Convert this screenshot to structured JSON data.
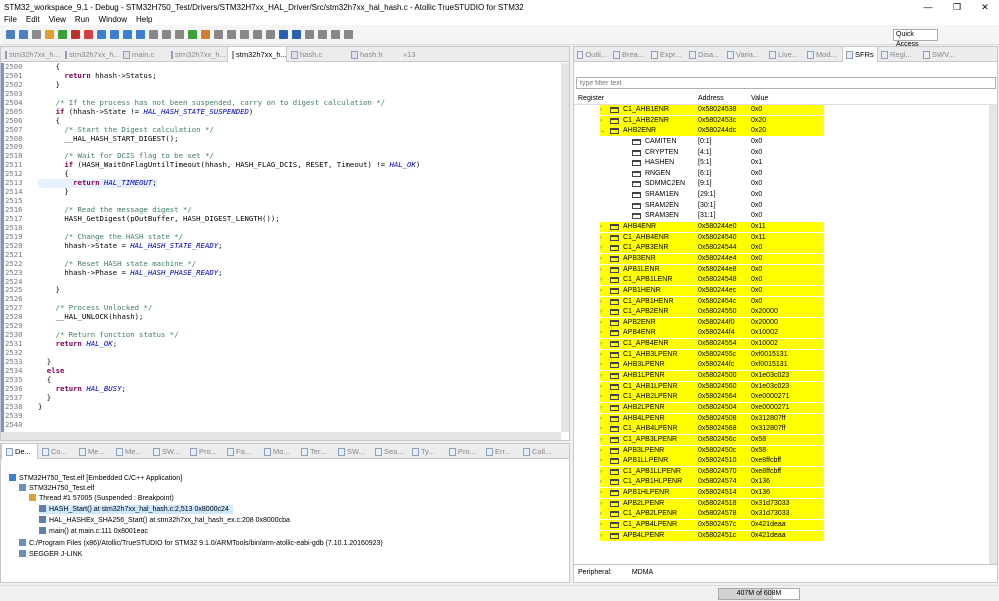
{
  "title": "STM32_workspace_9.1 - Debug - STM32H750_Test/Drivers/STM32H7xx_HAL_Driver/Src/stm32h7xx_hal_hash.c - Atollic TrueSTUDIO for STM32",
  "window_controls": [
    "—",
    "❐",
    "✕"
  ],
  "menu": [
    "File",
    "Edit",
    "View",
    "Run",
    "Window",
    "Help"
  ],
  "quick_access": "Quick Access",
  "editor_tabs": [
    {
      "label": "stm32h7xx_h...",
      "active": false
    },
    {
      "label": "stm32h7xx_h...",
      "active": false
    },
    {
      "label": "main.c",
      "active": false
    },
    {
      "label": "stm32h7xx_h...",
      "active": false
    },
    {
      "label": "stm32h7xx_h...",
      "active": true
    },
    {
      "label": "hash.c",
      "active": false
    },
    {
      "label": "hash.h",
      "active": false
    },
    {
      "label": "»13",
      "active": false
    }
  ],
  "code_lines": [
    {
      "n": "2500",
      "t": "    {"
    },
    {
      "n": "2501",
      "t": "      <k>return</k> hhash->Status;"
    },
    {
      "n": "2502",
      "t": "    }"
    },
    {
      "n": "2503",
      "t": ""
    },
    {
      "n": "2504",
      "t": "    <c>/* If the process has not been suspended, carry on to digest calculation */</c>"
    },
    {
      "n": "2505",
      "t": "    <k>if</k> (hhash->State != <i>HAL_HASH_STATE_SUSPENDED</i>)"
    },
    {
      "n": "2506",
      "t": "    {"
    },
    {
      "n": "2507",
      "t": "      <c>/* Start the Digest calculation */</c>"
    },
    {
      "n": "2508",
      "t": "      __HAL_HASH_START_DIGEST();"
    },
    {
      "n": "2509",
      "t": ""
    },
    {
      "n": "2510",
      "t": "      <c>/* Wait for DCIS flag to be set */</c>"
    },
    {
      "n": "2511",
      "t": "      <k>if</k> (HASH_WaitOnFlagUntilTimeout(hhash, HASH_FLAG_DCIS, RESET, Timeout) != <i>HAL_OK</i>)"
    },
    {
      "n": "2512",
      "t": "      {"
    },
    {
      "n": "2513",
      "t": "        <k>return</k> <i>HAL_TIMEOUT</i>;",
      "hl": true
    },
    {
      "n": "2514",
      "t": "      }"
    },
    {
      "n": "2515",
      "t": ""
    },
    {
      "n": "2516",
      "t": "      <c>/* Read the message digest */</c>"
    },
    {
      "n": "2517",
      "t": "      HASH_GetDigest(pOutBuffer, HASH_DIGEST_LENGTH());"
    },
    {
      "n": "2518",
      "t": ""
    },
    {
      "n": "2519",
      "t": "      <c>/* Change the HASH state */</c>"
    },
    {
      "n": "2520",
      "t": "      hhash->State = <i>HAL_HASH_STATE_READY</i>;"
    },
    {
      "n": "2521",
      "t": ""
    },
    {
      "n": "2522",
      "t": "      <c>/* Reset HASH state machine */</c>"
    },
    {
      "n": "2523",
      "t": "      hhash->Phase = <i>HAL_HASH_PHASE_READY</i>;"
    },
    {
      "n": "2524",
      "t": ""
    },
    {
      "n": "2525",
      "t": "    }"
    },
    {
      "n": "2526",
      "t": ""
    },
    {
      "n": "2527",
      "t": "    <c>/* Process Unlocked */</c>"
    },
    {
      "n": "2528",
      "t": "    __HAL_UNLOCK(hhash);"
    },
    {
      "n": "2529",
      "t": ""
    },
    {
      "n": "2530",
      "t": "    <c>/* Return function status */</c>"
    },
    {
      "n": "2531",
      "t": "    <k>return</k> <i>HAL_OK</i>;"
    },
    {
      "n": "2532",
      "t": ""
    },
    {
      "n": "2533",
      "t": "  }"
    },
    {
      "n": "2534",
      "t": "  <k>else</k>"
    },
    {
      "n": "2535",
      "t": "  {"
    },
    {
      "n": "2536",
      "t": "    <k>return</k> <i>HAL_BUSY</i>;"
    },
    {
      "n": "2537",
      "t": "  }"
    },
    {
      "n": "2538",
      "t": "}"
    },
    {
      "n": "2539",
      "t": ""
    },
    {
      "n": "2540",
      "t": ""
    }
  ],
  "right_tabs": [
    "Outli...",
    "Brea...",
    "Expr...",
    "Disa...",
    "Varia...",
    "Live...",
    "Mod...",
    "SFRs",
    "Regi...",
    "SWV..."
  ],
  "filter_placeholder": "type filter text",
  "columns": {
    "register": "Register",
    "address": "Address",
    "value": "Value"
  },
  "sfr_rows": [
    {
      "name": "C1_AHB1ENR",
      "addr": "0x58024538",
      "val": "0x0",
      "y": true,
      "lvl": 0,
      "exp": "›"
    },
    {
      "name": "C1_AHB2ENR",
      "addr": "0x5802453c",
      "val": "0x20",
      "y": true,
      "lvl": 0,
      "exp": "›"
    },
    {
      "name": "AHB2ENR",
      "addr": "0x580244dc",
      "val": "0x20",
      "y": true,
      "lvl": 0,
      "exp": "⌄"
    },
    {
      "name": "CAMITEN",
      "addr": "[0:1]",
      "val": "0x0",
      "y": false,
      "lvl": 1,
      "exp": ""
    },
    {
      "name": "CRYPTEN",
      "addr": "[4:1]",
      "val": "0x0",
      "y": false,
      "lvl": 1,
      "exp": ""
    },
    {
      "name": "HASHEN",
      "addr": "[5:1]",
      "val": "0x1",
      "y": false,
      "lvl": 1,
      "exp": ""
    },
    {
      "name": "RNGEN",
      "addr": "[6:1]",
      "val": "0x0",
      "y": false,
      "lvl": 1,
      "exp": ""
    },
    {
      "name": "SDMMC2EN",
      "addr": "[9:1]",
      "val": "0x0",
      "y": false,
      "lvl": 1,
      "exp": ""
    },
    {
      "name": "SRAM1EN",
      "addr": "[29:1]",
      "val": "0x0",
      "y": false,
      "lvl": 1,
      "exp": ""
    },
    {
      "name": "SRAM2EN",
      "addr": "[30:1]",
      "val": "0x0",
      "y": false,
      "lvl": 1,
      "exp": ""
    },
    {
      "name": "SRAM3EN",
      "addr": "[31:1]",
      "val": "0x0",
      "y": false,
      "lvl": 1,
      "exp": ""
    },
    {
      "name": "AHB4ENR",
      "addr": "0x580244e0",
      "val": "0x11",
      "y": true,
      "lvl": 0,
      "exp": "›"
    },
    {
      "name": "C1_AHB4ENR",
      "addr": "0x58024540",
      "val": "0x11",
      "y": true,
      "lvl": 0,
      "exp": "›"
    },
    {
      "name": "C1_APB3ENR",
      "addr": "0x58024544",
      "val": "0x0",
      "y": true,
      "lvl": 0,
      "exp": "›"
    },
    {
      "name": "APB3ENR",
      "addr": "0x580244e4",
      "val": "0x0",
      "y": true,
      "lvl": 0,
      "exp": "›"
    },
    {
      "name": "APB1LENR",
      "addr": "0x580244e8",
      "val": "0x0",
      "y": true,
      "lvl": 0,
      "exp": "›"
    },
    {
      "name": "C1_APB1LENR",
      "addr": "0x58024548",
      "val": "0x0",
      "y": true,
      "lvl": 0,
      "exp": "›"
    },
    {
      "name": "APB1HENR",
      "addr": "0x580244ec",
      "val": "0x0",
      "y": true,
      "lvl": 0,
      "exp": "›"
    },
    {
      "name": "C1_APB1HENR",
      "addr": "0x5802454c",
      "val": "0x0",
      "y": true,
      "lvl": 0,
      "exp": "›"
    },
    {
      "name": "C1_APB2ENR",
      "addr": "0x58024550",
      "val": "0x20000",
      "y": true,
      "lvl": 0,
      "exp": "›"
    },
    {
      "name": "APB2ENR",
      "addr": "0x580244f0",
      "val": "0x20000",
      "y": true,
      "lvl": 0,
      "exp": "›"
    },
    {
      "name": "APB4ENR",
      "addr": "0x580244f4",
      "val": "0x10002",
      "y": true,
      "lvl": 0,
      "exp": "›"
    },
    {
      "name": "C1_APB4ENR",
      "addr": "0x58024554",
      "val": "0x10002",
      "y": true,
      "lvl": 0,
      "exp": "›"
    },
    {
      "name": "C1_AHB3LPENR",
      "addr": "0x5802455c",
      "val": "0xf0015131",
      "y": true,
      "lvl": 0,
      "exp": "›"
    },
    {
      "name": "AHB3LPENR",
      "addr": "0x580244fc",
      "val": "0xf0015131",
      "y": true,
      "lvl": 0,
      "exp": "›"
    },
    {
      "name": "AHB1LPENR",
      "addr": "0x58024500",
      "val": "0x1e03c023",
      "y": true,
      "lvl": 0,
      "exp": "›"
    },
    {
      "name": "C1_AHB1LPENR",
      "addr": "0x58024560",
      "val": "0x1e03c023",
      "y": true,
      "lvl": 0,
      "exp": "›"
    },
    {
      "name": "C1_AHB2LPENR",
      "addr": "0x58024564",
      "val": "0xe0000271",
      "y": true,
      "lvl": 0,
      "exp": "›"
    },
    {
      "name": "AHB2LPENR",
      "addr": "0x58024504",
      "val": "0xe0000271",
      "y": true,
      "lvl": 0,
      "exp": "›"
    },
    {
      "name": "AHB4LPENR",
      "addr": "0x58024508",
      "val": "0x312807ff",
      "y": true,
      "lvl": 0,
      "exp": "›"
    },
    {
      "name": "C1_AHB4LPENR",
      "addr": "0x58024568",
      "val": "0x312807ff",
      "y": true,
      "lvl": 0,
      "exp": "›"
    },
    {
      "name": "C1_APB3LPENR",
      "addr": "0x5802456c",
      "val": "0x58",
      "y": true,
      "lvl": 0,
      "exp": "›"
    },
    {
      "name": "APB3LPENR",
      "addr": "0x5802450c",
      "val": "0x58",
      "y": true,
      "lvl": 0,
      "exp": "›"
    },
    {
      "name": "APB1LLPENR",
      "addr": "0x58024510",
      "val": "0xe8ffcbff",
      "y": true,
      "lvl": 0,
      "exp": "›"
    },
    {
      "name": "C1_APB1LLPENR",
      "addr": "0x58024570",
      "val": "0xe8ffcbff",
      "y": true,
      "lvl": 0,
      "exp": "›"
    },
    {
      "name": "C1_APB1HLPENR",
      "addr": "0x58024574",
      "val": "0x136",
      "y": true,
      "lvl": 0,
      "exp": "›"
    },
    {
      "name": "APB1HLPENR",
      "addr": "0x58024514",
      "val": "0x136",
      "y": true,
      "lvl": 0,
      "exp": "›"
    },
    {
      "name": "APB2LPENR",
      "addr": "0x58024518",
      "val": "0x31d73033",
      "y": true,
      "lvl": 0,
      "exp": "›"
    },
    {
      "name": "C1_APB2LPENR",
      "addr": "0x58024578",
      "val": "0x31d73033",
      "y": true,
      "lvl": 0,
      "exp": "›"
    },
    {
      "name": "C1_APB4LPENR",
      "addr": "0x5802457c",
      "val": "0x421deaa",
      "y": true,
      "lvl": 0,
      "exp": "›"
    },
    {
      "name": "APB4LPENR",
      "addr": "0x5802451c",
      "val": "0x421deaa",
      "y": true,
      "lvl": 0,
      "exp": "›"
    }
  ],
  "peripheral": {
    "label": "Peripheral:",
    "value": "MDMA"
  },
  "debug_tabs": [
    "De...",
    "Co...",
    "Me...",
    "Me...",
    "SW...",
    "Pro...",
    "Fa...",
    "Mo...",
    "Ter...",
    "SW...",
    "Sea...",
    "Ty...",
    "Pro...",
    "Err...",
    "Call..."
  ],
  "debug_tree": [
    {
      "text": "STM32H750_Test.elf [Embedded C/C++ Application]",
      "lvl": 0,
      "icon": "#3a7fd0"
    },
    {
      "text": "STM32H750_Test.elf",
      "lvl": 1,
      "icon": "#6a8fb8"
    },
    {
      "text": "Thread #1 57005 (Suspended : Breakpoint)",
      "lvl": 2,
      "icon": "#d9a33a"
    },
    {
      "text": "HASH_Start() at stm32h7xx_hal_hash.c:2,513 0x8000c24",
      "lvl": 3,
      "icon": "#5c7fa8",
      "sel": true
    },
    {
      "text": "HAL_HASHEx_SHA256_Start() at stm32h7xx_hal_hash_ex.c:208 0x8000cba",
      "lvl": 3,
      "icon": "#5c7fa8"
    },
    {
      "text": "main() at main.c:111 0x8001eac",
      "lvl": 3,
      "icon": "#5c7fa8"
    },
    {
      "text": "C:/Program Files (x86)/Atollic/TrueSTUDIO for STM32 9.1.0/ARMTools/bin/arm-atollic-eabi-gdb (7.10.1.20160923)",
      "lvl": 1,
      "icon": "#6a8fb8"
    },
    {
      "text": "SEGGER J-LINK",
      "lvl": 1,
      "icon": "#6a8fb8"
    }
  ],
  "heap": {
    "label": "407M of 608M",
    "used": 407,
    "total": 608
  }
}
